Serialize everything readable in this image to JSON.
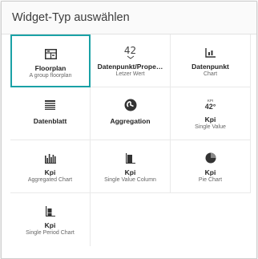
{
  "dialog": {
    "title": "Widget-Typ auswählen"
  },
  "widgets": [
    {
      "name": "Floorplan",
      "subtitle": "A group floorplan",
      "icon": "floorplan-icon",
      "selected": true
    },
    {
      "name": "Datenpunkt/Prope…",
      "subtitle": "Letzer Wert",
      "icon": "last-value-icon",
      "icon_text": "42"
    },
    {
      "name": "Datenpunkt",
      "subtitle": "Chart",
      "icon": "line-chart-icon"
    },
    {
      "name": "Datenblatt",
      "subtitle": "",
      "icon": "datasheet-icon"
    },
    {
      "name": "Aggregation",
      "subtitle": "",
      "icon": "aggregation-icon"
    },
    {
      "name": "Kpi",
      "subtitle": "Single Value",
      "icon": "kpi-value-icon",
      "icon_text_top": "KPI",
      "icon_text": "42°"
    },
    {
      "name": "Kpi",
      "subtitle": "Aggregated Chart",
      "icon": "bar-chart-icon"
    },
    {
      "name": "Kpi",
      "subtitle": "Single Value Column",
      "icon": "column-icon"
    },
    {
      "name": "Kpi",
      "subtitle": "Pie Chart",
      "icon": "pie-chart-icon"
    },
    {
      "name": "Kpi",
      "subtitle": "Single Period Chart",
      "icon": "single-period-icon"
    }
  ],
  "colors": {
    "accent": "#1aa1a6",
    "icon": "#333333"
  }
}
